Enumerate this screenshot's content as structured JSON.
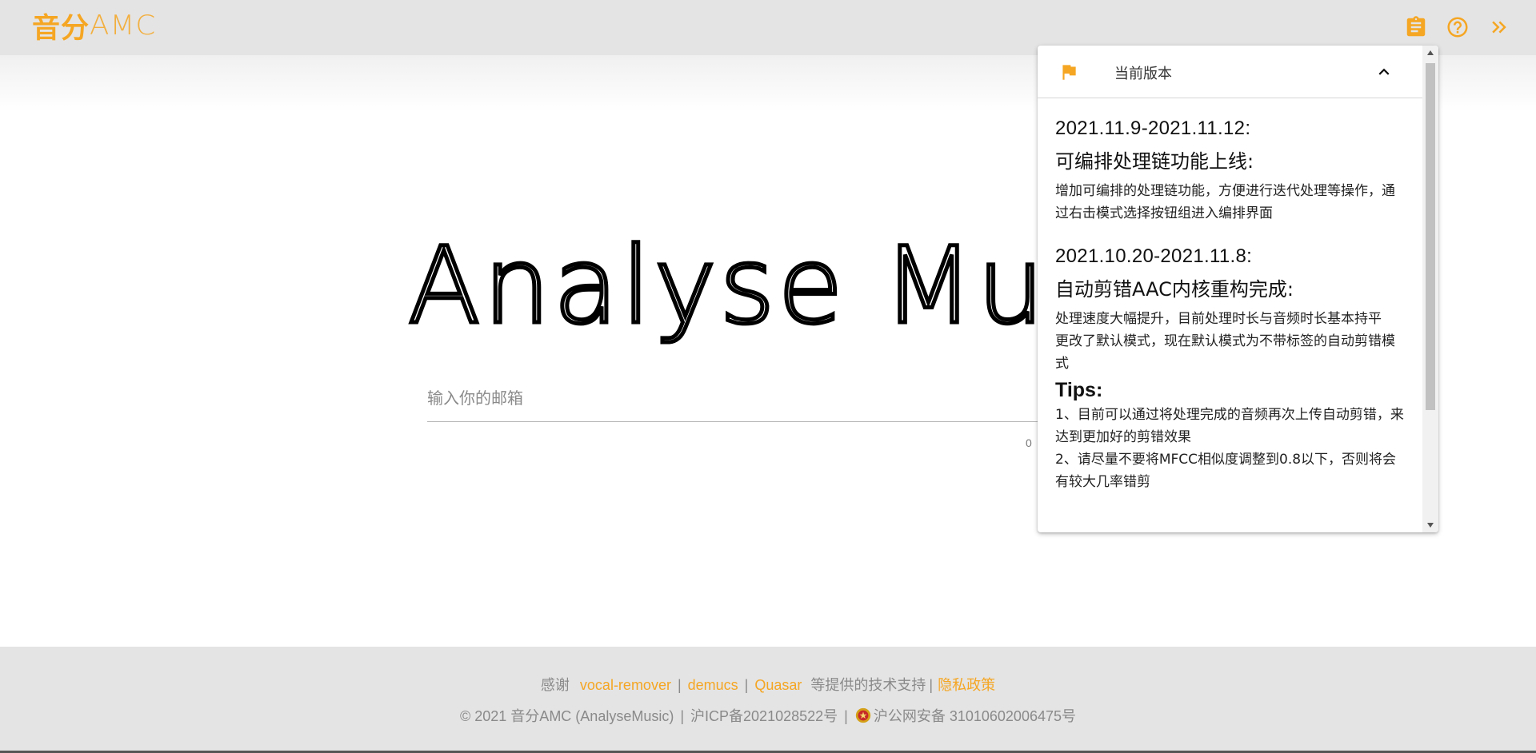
{
  "header": {
    "logo_cn": "音分",
    "logo_en": "AMC",
    "actions": [
      {
        "name": "clipboard-icon",
        "color": "#f5a623"
      },
      {
        "name": "help-icon",
        "color": "#f5a623"
      },
      {
        "name": "double-chevron-right-icon",
        "color": "#f5a623"
      }
    ]
  },
  "main": {
    "hero_text": "Analyse Musi",
    "email_placeholder": "输入你的邮箱",
    "email_value": "",
    "counter": "0"
  },
  "version_panel": {
    "title": "当前版本",
    "flag_icon": "flag-icon",
    "collapse_icon": "chevron-up-icon",
    "entries": [
      {
        "date": "2021.11.9-2021.11.12:",
        "title": "可编排处理链功能上线:",
        "desc": [
          "增加可编排的处理链功能，方便进行迭代处理等操作，通过右击模式选择按钮组进入编排界面"
        ]
      },
      {
        "date": "2021.10.20-2021.11.8:",
        "title": "自动剪错AAC内核重构完成:",
        "desc": [
          "处理速度大幅提升，目前处理时长与音频时长基本持平",
          "更改了默认模式，现在默认模式为不带标签的自动剪错模式"
        ]
      }
    ],
    "tips_title": "Tips:",
    "tips": [
      "1、目前可以通过将处理完成的音频再次上传自动剪错，来达到更加好的剪错效果",
      "2、请尽量不要将MFCC相似度调整到0.8以下，否则将会有较大几率错剪"
    ]
  },
  "footer": {
    "thanks_prefix": "感谢",
    "links": [
      "vocal-remover",
      "demucs",
      "Quasar"
    ],
    "thanks_suffix": "等提供的技术支持",
    "privacy": "隐私政策",
    "copyright": "© 2021 音分AMC (AnalyseMusic)",
    "icp": "沪ICP备2021028522号",
    "police": "沪公网安备 31010602006475号"
  },
  "colors": {
    "accent": "#f5a623",
    "header_bg": "#e4e4e4",
    "footer_text": "#8a8a8a"
  }
}
